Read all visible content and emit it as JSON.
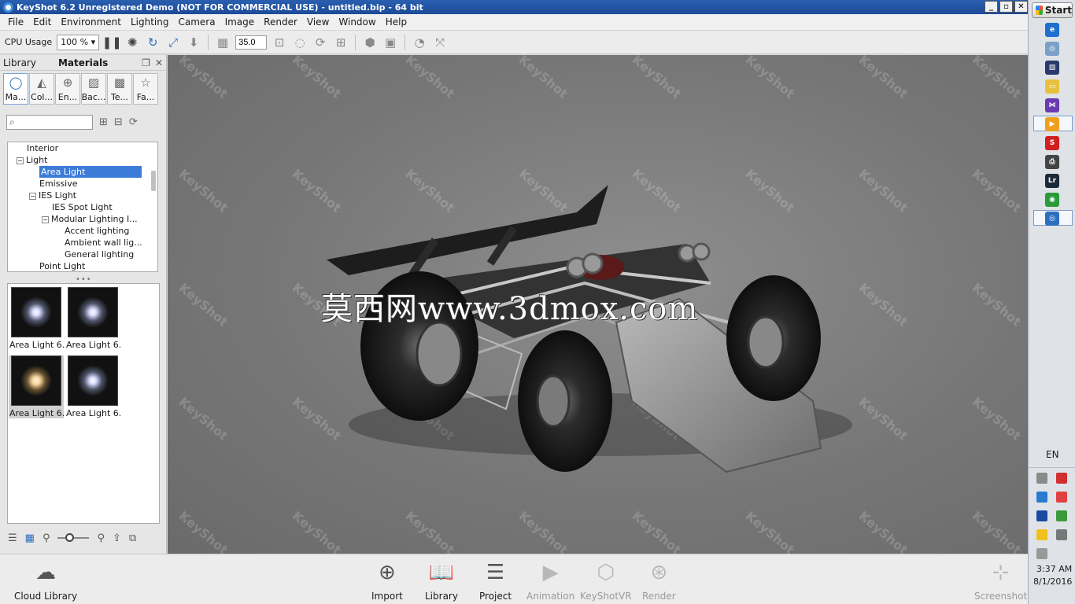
{
  "window": {
    "title": "KeyShot 6.2 Unregistered Demo (NOT FOR COMMERCIAL USE) - untitled.bip  - 64 bit",
    "btn_minimize": "_",
    "btn_restore": "▫",
    "btn_close": "✕"
  },
  "menu": [
    "File",
    "Edit",
    "Environment",
    "Lighting",
    "Camera",
    "Image",
    "Render",
    "View",
    "Window",
    "Help"
  ],
  "toolbar": {
    "cpu_label": "CPU Usage",
    "cpu_value": "100 %",
    "fov_value": "35.0"
  },
  "library": {
    "tab_library": "Library",
    "tab_materials": "Materials",
    "categories": [
      "Ma...",
      "Col...",
      "En...",
      "Bac...",
      "Te...",
      "Fa..."
    ],
    "search_placeholder": "",
    "tree": [
      {
        "label": "Interior",
        "indent": 0,
        "toggle": ""
      },
      {
        "label": "Light",
        "indent": 0,
        "toggle": "−"
      },
      {
        "label": "Area Light",
        "indent": 1,
        "toggle": "",
        "selected": true
      },
      {
        "label": "Emissive",
        "indent": 1,
        "toggle": ""
      },
      {
        "label": "IES Light",
        "indent": 1,
        "toggle": "−"
      },
      {
        "label": "IES Spot Light",
        "indent": 2,
        "toggle": ""
      },
      {
        "label": "Modular Lighting I...",
        "indent": 2,
        "toggle": "−"
      },
      {
        "label": "Accent lighting",
        "indent": 3,
        "toggle": ""
      },
      {
        "label": "Ambient wall lig...",
        "indent": 3,
        "toggle": ""
      },
      {
        "label": "General lighting",
        "indent": 3,
        "toggle": ""
      },
      {
        "label": "Point Light",
        "indent": 1,
        "toggle": ""
      }
    ],
    "thumbnails": [
      {
        "label": "Area Light 6...",
        "warm": false,
        "selected": false
      },
      {
        "label": "Area Light 6...",
        "warm": false,
        "selected": false
      },
      {
        "label": "Area Light 6...",
        "warm": true,
        "selected": true
      },
      {
        "label": "Area Light 6...",
        "warm": false,
        "selected": false
      }
    ]
  },
  "viewport": {
    "watermark": "KeyShot",
    "overlay_text": "莫西网www.3dmox.com"
  },
  "ribbon": {
    "cloud_library": "Cloud Library",
    "import": "Import",
    "library": "Library",
    "project": "Project",
    "animation": "Animation",
    "keyshotvr": "KeyShotVR",
    "render": "Render",
    "screenshot": "Screenshot"
  },
  "taskbar": {
    "start": "Start",
    "language": "EN",
    "time": "3:37 AM",
    "date": "8/1/2016"
  },
  "colors": {
    "accent": "#2b6fc0",
    "selection": "#3d7bd8",
    "title_bar": "#1c4a96"
  }
}
